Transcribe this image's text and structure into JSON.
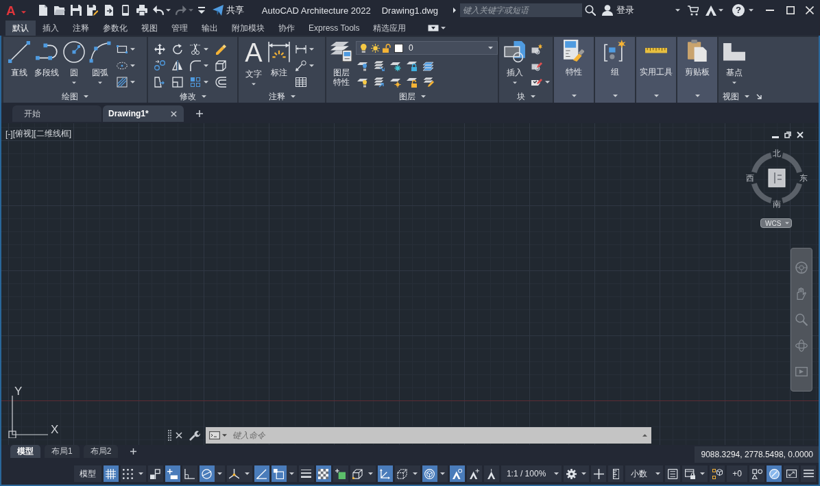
{
  "title_bar": {
    "app_menu": "A",
    "quick_access": [
      {
        "disabled": false,
        "dropdown": false
      },
      {
        "disabled": false,
        "dropdown": false
      },
      {
        "disabled": false,
        "dropdown": false
      },
      {
        "disabled": false,
        "dropdown": false
      },
      {
        "disabled": false,
        "dropdown": false
      },
      {
        "disabled": false,
        "dropdown": false
      },
      {
        "disabled": false,
        "dropdown": false
      },
      {
        "disabled": false,
        "dropdown": true
      },
      {
        "disabled": true,
        "dropdown": true
      },
      {
        "disabled": false,
        "dropdown": false
      }
    ],
    "share": "共享",
    "app_title": "AutoCAD Architecture 2022",
    "document": "Drawing1.dwg",
    "search": {
      "placeholder": "键入关键字或短语"
    },
    "sign_in": "登录",
    "help": "?"
  },
  "ribbon_tabs": [
    {
      "label": "默认",
      "selected": true
    },
    {
      "label": "插入",
      "selected": false
    },
    {
      "label": "注释",
      "selected": false
    },
    {
      "label": "参数化",
      "selected": false
    },
    {
      "label": "视图",
      "selected": false
    },
    {
      "label": "管理",
      "selected": false
    },
    {
      "label": "输出",
      "selected": false
    },
    {
      "label": "附加模块",
      "selected": false
    },
    {
      "label": "协作",
      "selected": false
    },
    {
      "label": "Express Tools",
      "selected": false
    },
    {
      "label": "精选应用",
      "selected": false
    }
  ],
  "ribbon_panels": [
    {
      "kind": "tools",
      "title": "绘图",
      "large_tools": [
        {
          "label": "直线",
          "dropdown": false
        },
        {
          "label": "多段线",
          "dropdown": false
        },
        {
          "label": "圆",
          "dropdown": true
        },
        {
          "label": "圆弧",
          "dropdown": true
        }
      ]
    },
    {
      "kind": "tools",
      "title": "修改"
    },
    {
      "kind": "tools",
      "title": "注释",
      "large_tools": [
        {
          "label": "文字",
          "glyph": "A",
          "dropdown": true
        },
        {
          "label": "标注",
          "dropdown": false
        }
      ]
    },
    {
      "kind": "tools",
      "title": "图层",
      "large_tools": [
        {
          "label": "图层特性",
          "dropdown": false
        }
      ],
      "layer_dropdown": {
        "value": "0"
      }
    },
    {
      "kind": "tools",
      "title": "块",
      "large_tools": [
        {
          "label": "插入",
          "dropdown": true
        }
      ]
    },
    {
      "kind": "collapsed",
      "title": "特性"
    },
    {
      "kind": "collapsed",
      "title": "组"
    },
    {
      "kind": "collapsed",
      "title": "实用工具"
    },
    {
      "kind": "collapsed",
      "title": "剪贴板"
    },
    {
      "kind": "tools",
      "title": "视图",
      "large_tools": [
        {
          "label": "基点",
          "dropdown": true
        }
      ],
      "dialog_launcher": true
    }
  ],
  "file_tabs": [
    {
      "label": "开始",
      "selected": false,
      "closable": false
    },
    {
      "label": "Drawing1*",
      "selected": true,
      "closable": true
    }
  ],
  "viewport": {
    "controls": [
      "[-]",
      "[俯视]",
      "[二维线框]"
    ],
    "viewcube": {
      "north": "北",
      "west": "西",
      "east": "东",
      "south": "南",
      "wcs": "WCS"
    },
    "ucs": {
      "y": "Y",
      "x": "X"
    },
    "command_line": {
      "placeholder": "键入命令"
    }
  },
  "layout_tabs": [
    {
      "label": "模型",
      "selected": true
    },
    {
      "label": "布局1",
      "selected": false
    },
    {
      "label": "布局2",
      "selected": false
    }
  ],
  "coordinates": "9088.3294, 2778.5498, 0.0000",
  "status_bar": [
    {
      "kind": "text",
      "label": "模型",
      "dropdown": false
    },
    {
      "kind": "toggle",
      "on": true,
      "dropdown": false
    },
    {
      "kind": "toggle",
      "on": false,
      "dropdown": true
    },
    {
      "kind": "toggle",
      "on": false,
      "dropdown": false
    },
    {
      "kind": "toggle",
      "on": true,
      "dropdown": false
    },
    {
      "kind": "toggle",
      "on": false,
      "dropdown": false
    },
    {
      "kind": "toggle",
      "on": true,
      "dropdown": true
    },
    {
      "kind": "toggle",
      "on": false,
      "dropdown": true
    },
    {
      "kind": "toggle",
      "on": true,
      "dropdown": false
    },
    {
      "kind": "toggle",
      "on": true,
      "dropdown": true
    },
    {
      "kind": "toggle",
      "on": false,
      "dropdown": false
    },
    {
      "kind": "toggle",
      "on": true,
      "dropdown": false
    },
    {
      "kind": "toggle",
      "on": false,
      "dropdown": false
    },
    {
      "kind": "toggle",
      "on": false,
      "dropdown": true
    },
    {
      "kind": "toggle",
      "on": true,
      "dropdown": false
    },
    {
      "kind": "toggle",
      "on": false,
      "dropdown": true
    },
    {
      "kind": "toggle",
      "on": true,
      "dropdown": true
    },
    {
      "kind": "toggle",
      "on": true,
      "dropdown": false
    },
    {
      "kind": "toggle",
      "on": false,
      "dropdown": false
    },
    {
      "kind": "toggle",
      "on": false,
      "dropdown": false
    },
    {
      "kind": "text",
      "label": "1:1 / 100%",
      "dropdown": true
    },
    {
      "kind": "toggle",
      "on": false,
      "dropdown": true
    },
    {
      "kind": "toggle",
      "on": false,
      "dropdown": false
    },
    {
      "kind": "toggle",
      "on": false,
      "dropdown": false
    },
    {
      "kind": "text",
      "label": "小数",
      "dropdown": true
    },
    {
      "kind": "toggle",
      "on": false,
      "dropdown": false
    },
    {
      "kind": "toggle",
      "on": false,
      "dropdown": true
    },
    {
      "kind": "toggle",
      "on": false,
      "dropdown": false
    },
    {
      "kind": "text",
      "label": "+0",
      "dropdown": false
    },
    {
      "kind": "toggle",
      "on": false,
      "dropdown": false
    },
    {
      "kind": "toggle",
      "on": true,
      "dropdown": false
    },
    {
      "kind": "toggle",
      "on": false,
      "dropdown": false
    },
    {
      "kind": "toggle",
      "on": false,
      "dropdown": false
    }
  ]
}
